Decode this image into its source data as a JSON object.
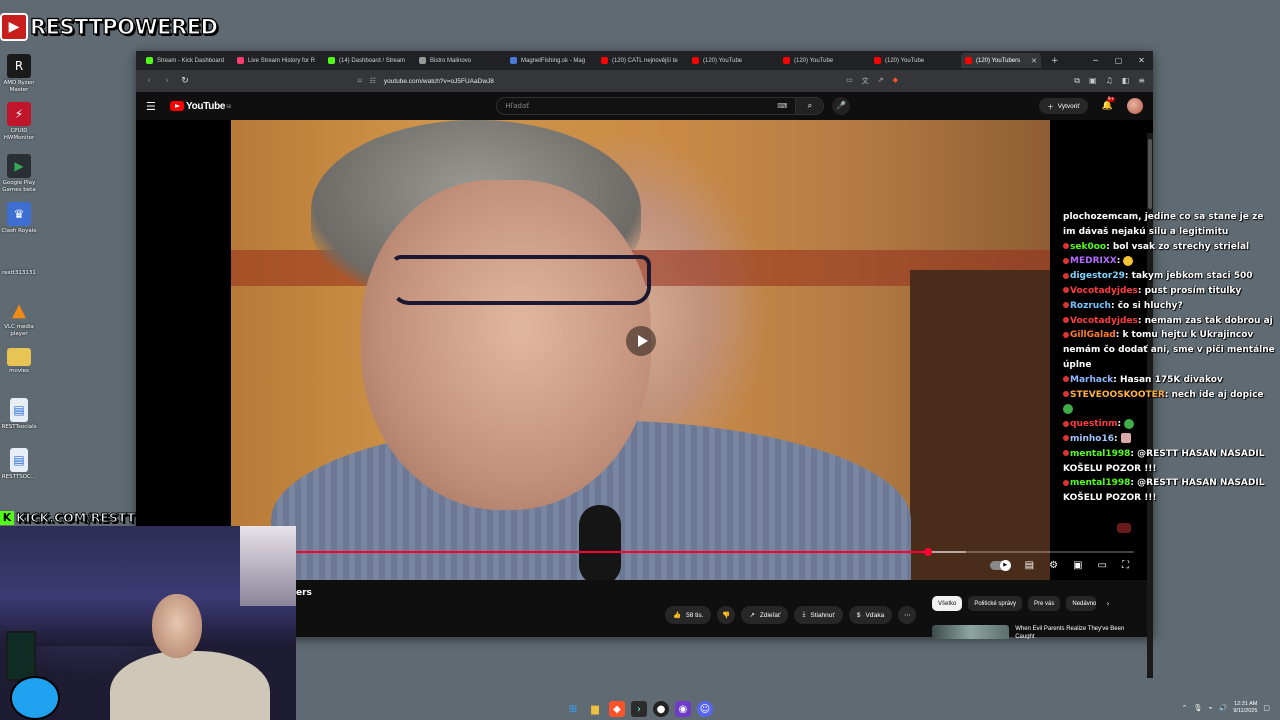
{
  "brand": {
    "title": "RESTTPOWERED"
  },
  "desktop_icons": [
    {
      "label": "AMD Ryzen Master",
      "color": "#1a1a1a"
    },
    {
      "label": "CPUID HWMonitor",
      "color": "#c0152b"
    },
    {
      "label": "Google Play Games beta",
      "color": "#2a2f36"
    },
    {
      "label": "Clash Royale",
      "color": "#3c6fd1"
    },
    {
      "label": "restt313131",
      "color": "#5f6a72"
    },
    {
      "label": "VLC media player",
      "color": "#f28a17"
    },
    {
      "label": "movies",
      "color": "#e7c453"
    },
    {
      "label": "RESTTsocials",
      "color": "#e8eef5"
    },
    {
      "label": "RESTTSOC...",
      "color": "#e8eef5"
    }
  ],
  "browser": {
    "tabs": [
      {
        "label": "Stream - Kick Dashboard",
        "color": "#53fc18",
        "active": false
      },
      {
        "label": "Live Stream History for R",
        "color": "#ff3d6e",
        "active": false
      },
      {
        "label": "(14) Dashboard / Stream",
        "color": "#53fc18",
        "active": false
      },
      {
        "label": "Bistro Malinovo",
        "color": "#999999",
        "active": false
      },
      {
        "label": "MagnetFishing.sk - Mag",
        "color": "#4a7bd8",
        "active": false
      },
      {
        "label": "(120) CATL nejnovější te",
        "color": "#ff0000",
        "active": false
      },
      {
        "label": "(120) YouTube",
        "color": "#ff0000",
        "active": false
      },
      {
        "label": "(120) YouTube",
        "color": "#ff0000",
        "active": false
      },
      {
        "label": "(120) YouTube",
        "color": "#ff0000",
        "active": false
      },
      {
        "label": "(120) YouTubers",
        "color": "#ff0000",
        "active": true
      }
    ],
    "new_tab": "+",
    "url": "youtube.com/watch?v=oJ5FUAaDwJ8"
  },
  "youtube": {
    "logo_text": "YouTube",
    "region": "SK",
    "search_placeholder": "Hľadať",
    "create_label": "Vytvoriť",
    "notifications": "9+",
    "video_title_fragment": "ers",
    "progress": {
      "played_pct": 75.5,
      "buffered_pct": 80
    },
    "likes": "58 tis.",
    "share_label": "Zdieľať",
    "download_label": "Stiahnuť",
    "thanks_label": "Vďaka",
    "chips": [
      {
        "label": "Všetko",
        "selected": true
      },
      {
        "label": "Politické správy",
        "selected": false
      },
      {
        "label": "Pre vás",
        "selected": false
      },
      {
        "label": "Nedávno",
        "selected": false
      }
    ],
    "recommendation_title": "When Evil Parents Realize They've Been Caught"
  },
  "chat": [
    {
      "user": "",
      "color": "#ffffff",
      "text": "plochozemcam, jedine co sa stane je ze im dávaš nejakú silu a legitimitu"
    },
    {
      "user": "sek0oo",
      "color": "#53fc18",
      "text": "bol vsak zo strechy strielal"
    },
    {
      "user": "MEDRIXX",
      "color": "#b26cff",
      "text": "",
      "emote": "yellow"
    },
    {
      "user": "digestor29",
      "color": "#7fd4ff",
      "text": "takym jebkom staci 500"
    },
    {
      "user": "Vocotadyjdes",
      "color": "#ff3b3b",
      "text": "pust prosím titulky"
    },
    {
      "user": "Rozruch",
      "color": "#6ec6ff",
      "text": "čo si hluchy?"
    },
    {
      "user": "Vocotadyjdes",
      "color": "#ff3b3b",
      "text": "nemam zas tak dobrou aj"
    },
    {
      "user": "GillGalad",
      "color": "#ff7b2e",
      "text": "k tomu hejtu k Ukrajincov nemám čo dodať ani, sme v piči mentálne úplne"
    },
    {
      "user": "Marhack",
      "color": "#8fb8ff",
      "text": "Hasan 175K divakov"
    },
    {
      "user": "STEVEOOSKOOTER",
      "color": "#ffb347",
      "text": "nech ide aj dopice",
      "emote": "green"
    },
    {
      "user": "questinm",
      "color": "#ff3b3b",
      "text": "",
      "emote": "green"
    },
    {
      "user": "minho16",
      "color": "#9fc5ff",
      "text": "",
      "emote": "img"
    },
    {
      "user": "mental1998",
      "color": "#53fc18",
      "text": "@RESTT HASAN NASADIL KOŠELU POZOR !!!"
    },
    {
      "user": "mental1998",
      "color": "#53fc18",
      "text": "@RESTT HASAN NASADIL KOŠELU POZOR !!!"
    }
  ],
  "kick": {
    "label": "KICK.COM/RESTT"
  },
  "taskbar": {
    "time": "12:31 AM",
    "date": "9/11/2025"
  }
}
